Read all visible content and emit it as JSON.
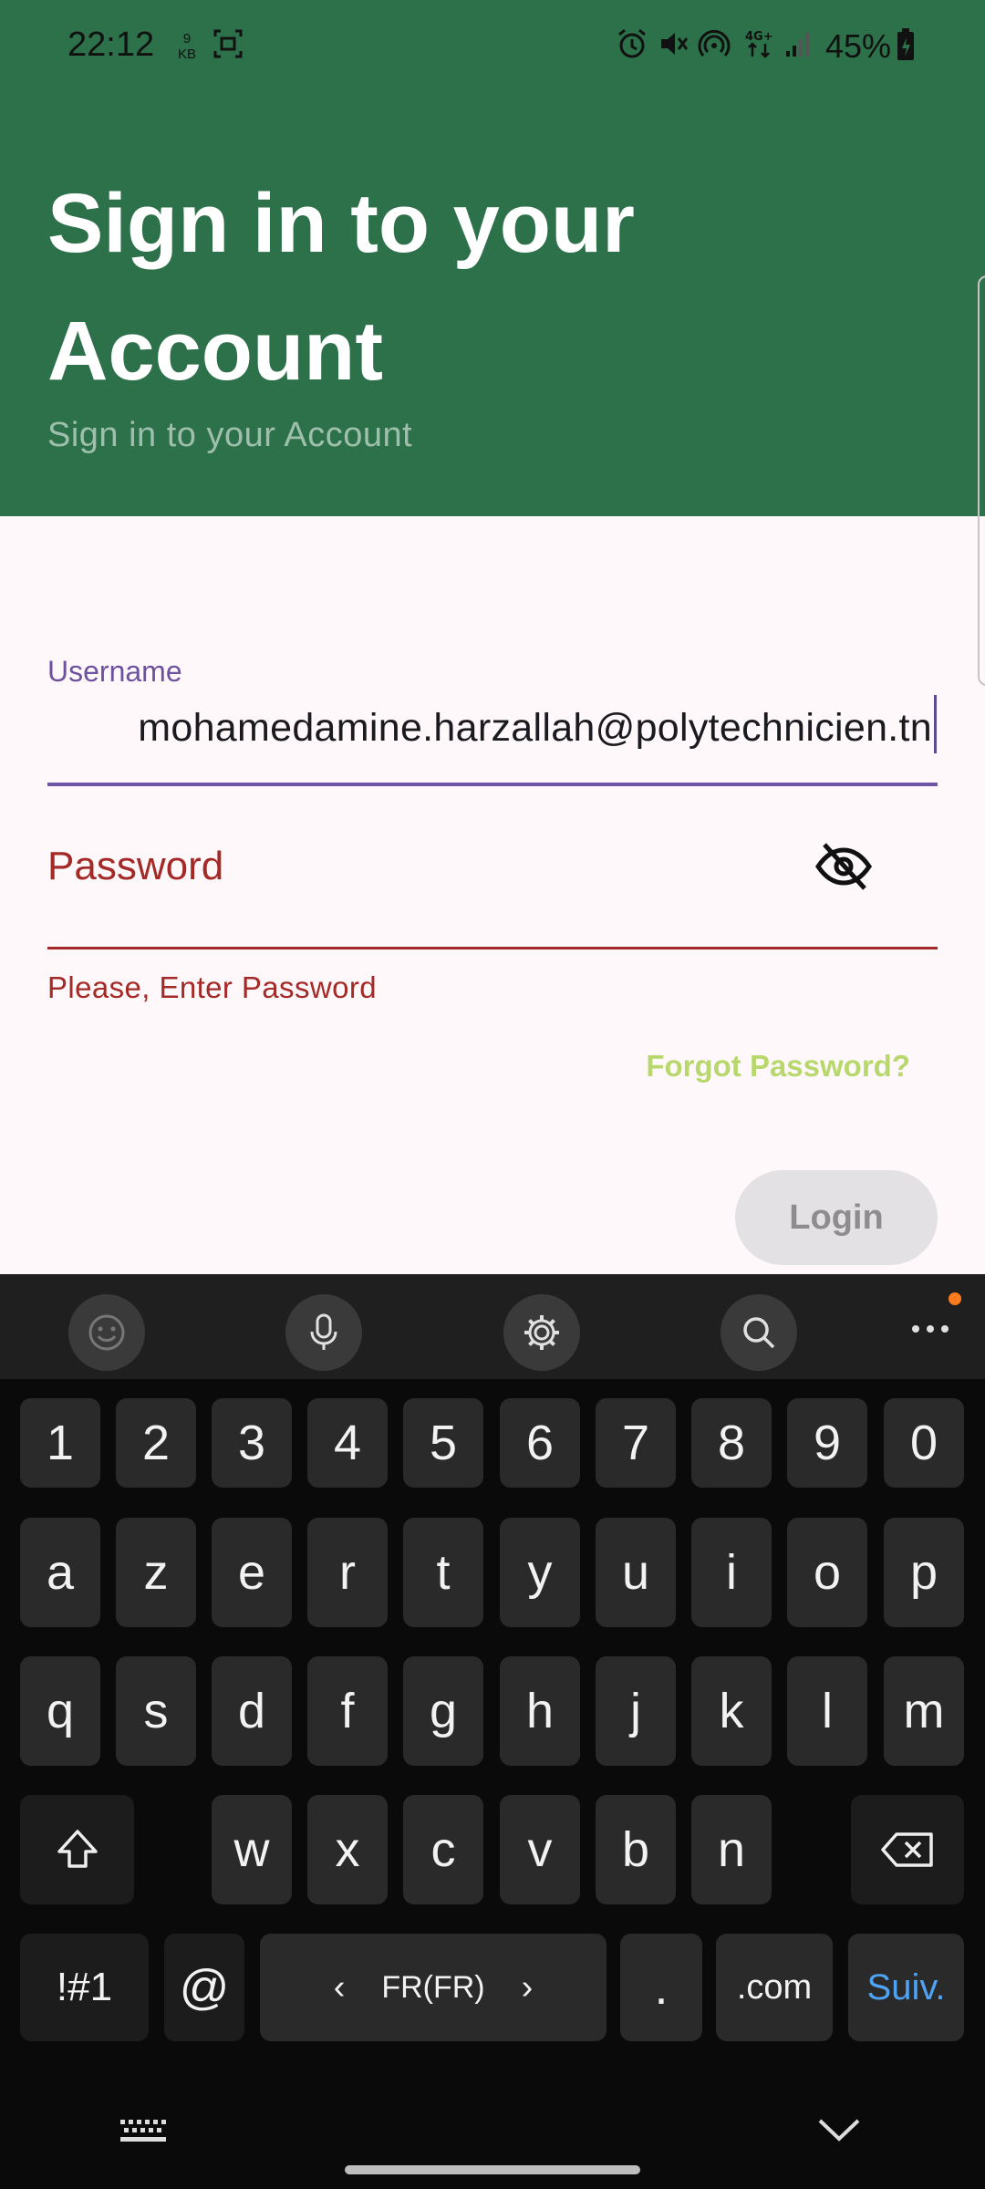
{
  "status_bar": {
    "time": "22:12",
    "data_speed_value": "9",
    "data_speed_unit": "KB",
    "network": "4G+",
    "battery_percent": "45%"
  },
  "header": {
    "title": "Sign in to your Account",
    "subtitle": "Sign in to your Account"
  },
  "form": {
    "username_label": "Username",
    "username_value": "mohamedamine.harzallah@polytechnicien.tn",
    "password_label": "Password",
    "password_error": "Please, Enter Password",
    "forgot_password": "Forgot Password?",
    "login_button": "Login"
  },
  "keyboard": {
    "number_row": [
      "1",
      "2",
      "3",
      "4",
      "5",
      "6",
      "7",
      "8",
      "9",
      "0"
    ],
    "row1": [
      "a",
      "z",
      "e",
      "r",
      "t",
      "y",
      "u",
      "i",
      "o",
      "p"
    ],
    "row2": [
      "q",
      "s",
      "d",
      "f",
      "g",
      "h",
      "j",
      "k",
      "l",
      "m"
    ],
    "row3": [
      "w",
      "x",
      "c",
      "v",
      "b",
      "n"
    ],
    "symbols_key": "!#1",
    "at_key": "@",
    "language": "FR(FR)",
    "period_key": ".",
    "dotcom_key": ".com",
    "next_key": "Suiv."
  },
  "colors": {
    "header_bg": "#2d714b",
    "username_accent": "#7156a8",
    "error": "#a42a27",
    "forgot_link": "#b8d86e",
    "suiv_blue": "#4fa3f5"
  }
}
